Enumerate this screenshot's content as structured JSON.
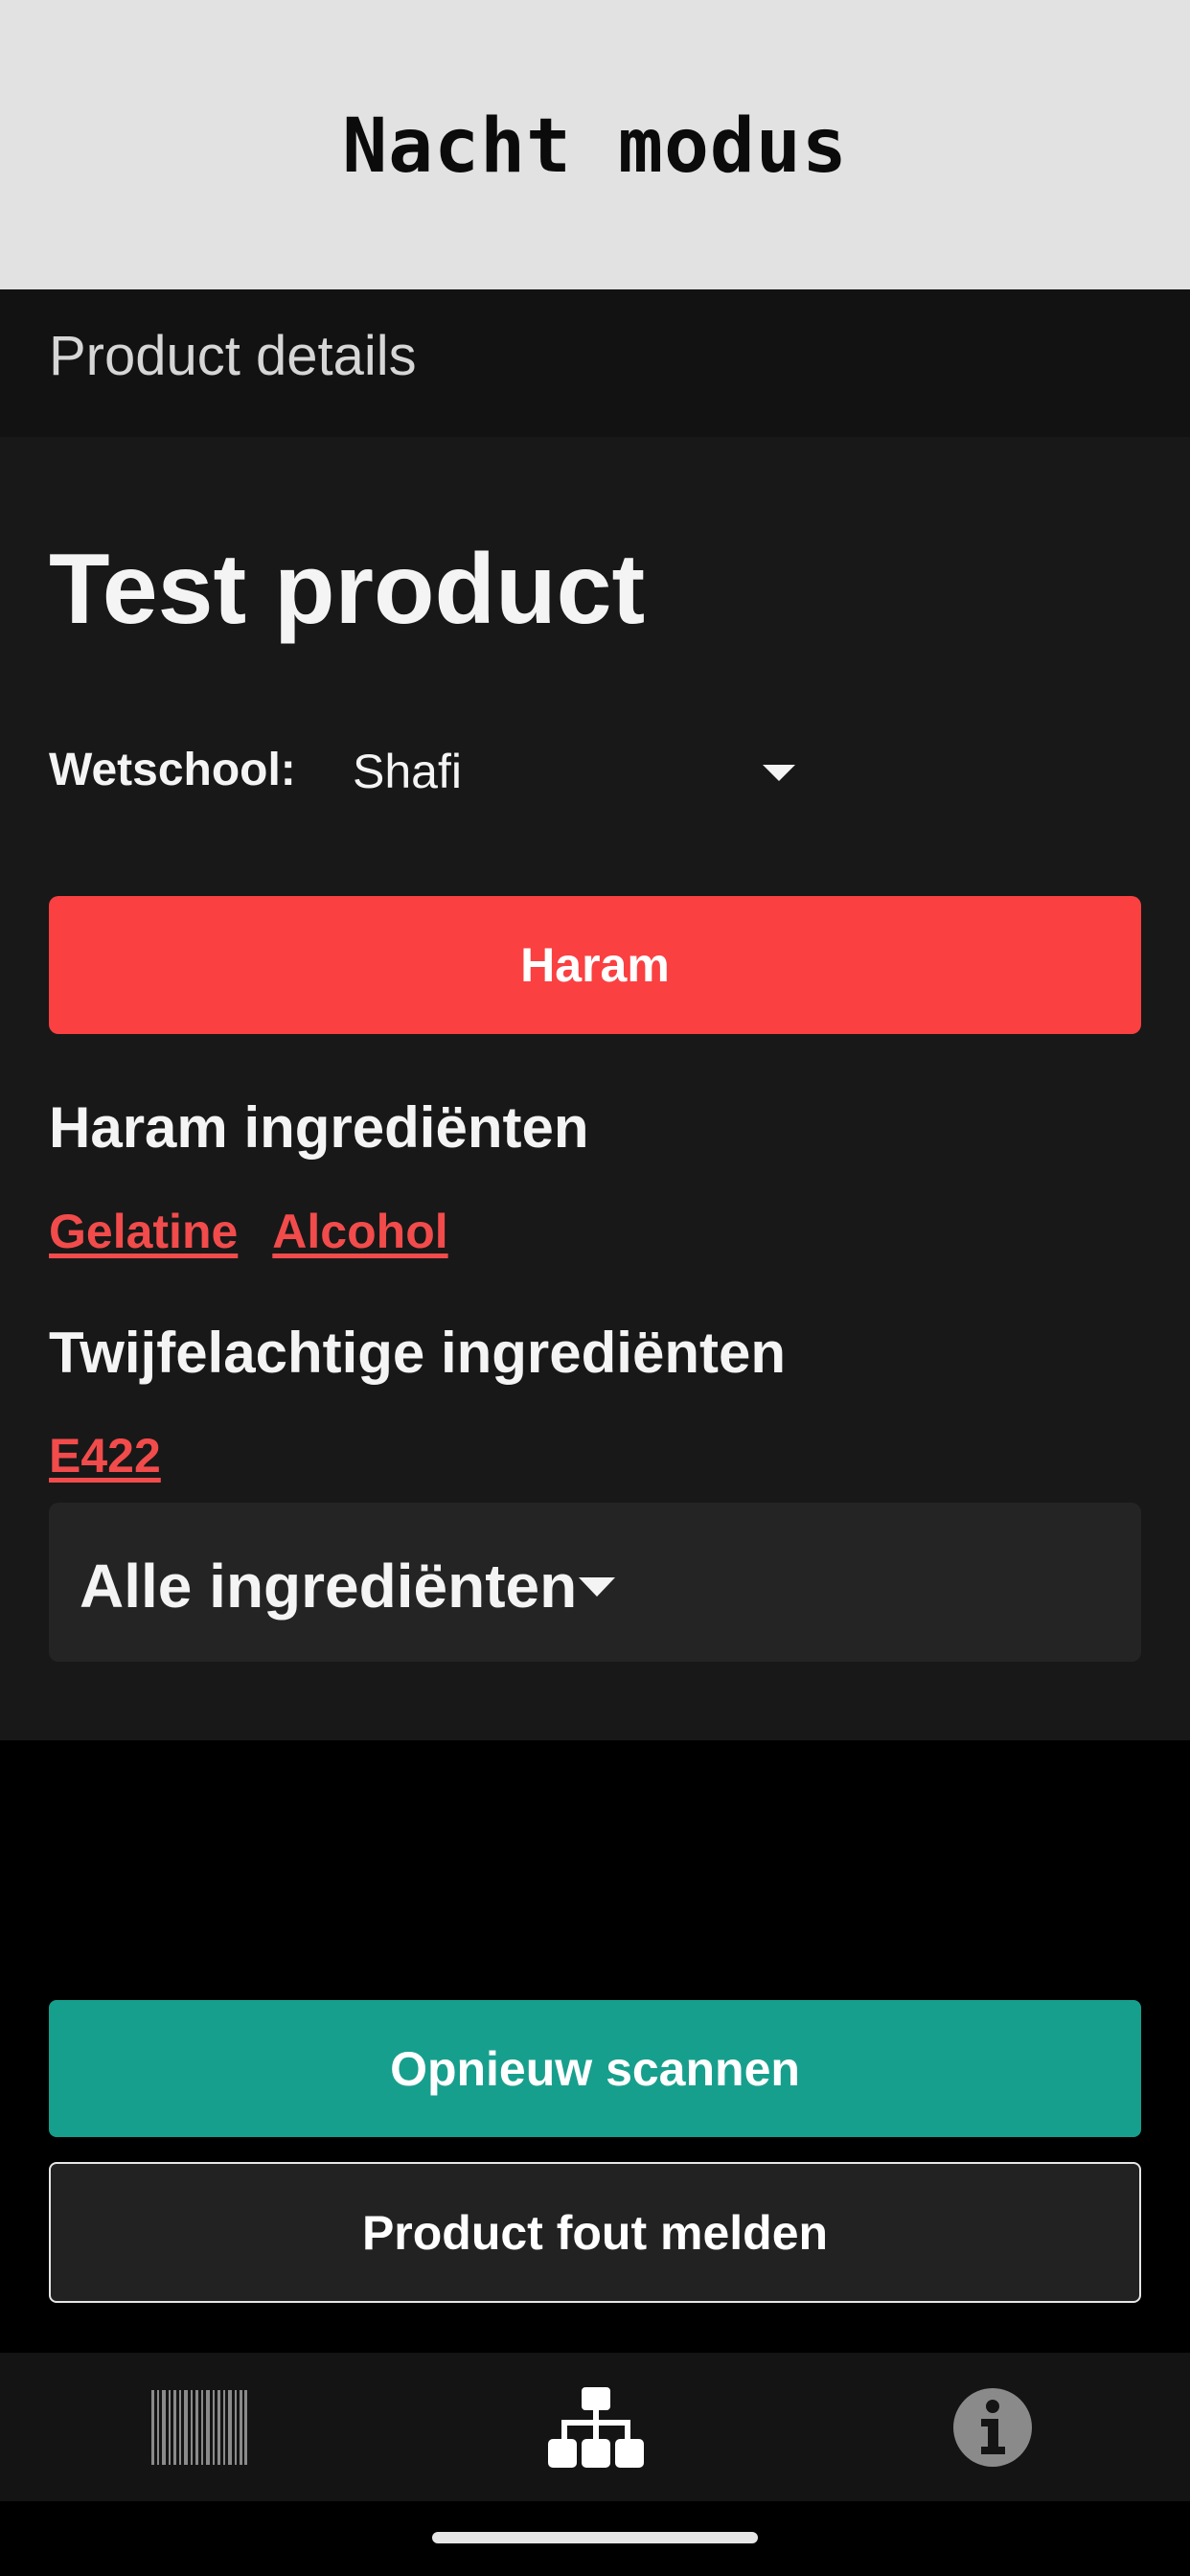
{
  "top_banner": {
    "title": "Nacht modus"
  },
  "app_bar": {
    "title": "Product details"
  },
  "product": {
    "name": "Test product",
    "school_label": "Wetschool:",
    "school_value": "Shafi",
    "status": "Haram",
    "status_color": "#FA4041"
  },
  "haram_section": {
    "heading": "Haram ingrediënten",
    "items": [
      "Gelatine",
      "Alcohol"
    ]
  },
  "doubtful_section": {
    "heading": "Twijfelachtige ingrediënten",
    "items": [
      "E422"
    ]
  },
  "all_ingredients": {
    "label": "Alle ingrediënten"
  },
  "actions": {
    "rescan_label": "Opnieuw scannen",
    "rescan_color": "#179F8D",
    "report_label": "Product fout melden"
  },
  "bottom_nav": {
    "items": [
      {
        "icon": "barcode-icon",
        "active": false
      },
      {
        "icon": "sitemap-icon",
        "active": true
      },
      {
        "icon": "info-icon",
        "active": false
      }
    ]
  }
}
